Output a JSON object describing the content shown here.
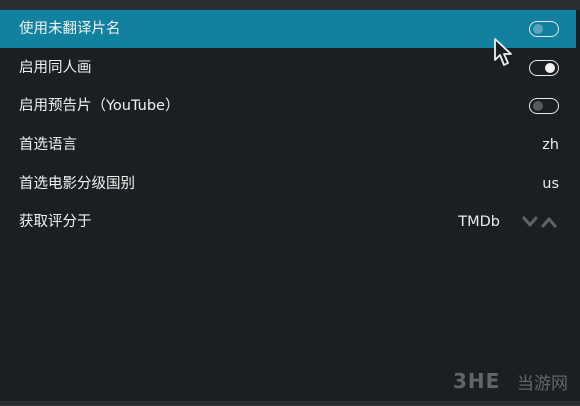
{
  "settings": [
    {
      "label": "使用未翻译片名",
      "type": "toggle",
      "state": "off",
      "focused": true
    },
    {
      "label": "启用同人画",
      "type": "toggle",
      "state": "on"
    },
    {
      "label": "启用预告片（YouTube）",
      "type": "toggle",
      "state": "off"
    },
    {
      "label": "首选语言",
      "type": "value",
      "value": "zh"
    },
    {
      "label": "首选电影分级国别",
      "type": "value",
      "value": "us"
    },
    {
      "label": "获取评分于",
      "type": "spinner",
      "value": "TMDb"
    }
  ],
  "icons": {
    "spinner_down": "chevron-down-icon",
    "spinner_up": "chevron-up-icon",
    "cursor": "mouse-pointer-icon"
  },
  "watermark": {
    "logo": "3HE",
    "text": "当游网"
  },
  "colors": {
    "background": "#1b1f21",
    "focus_highlight": "#12809f",
    "text": "#f2f2f2"
  }
}
